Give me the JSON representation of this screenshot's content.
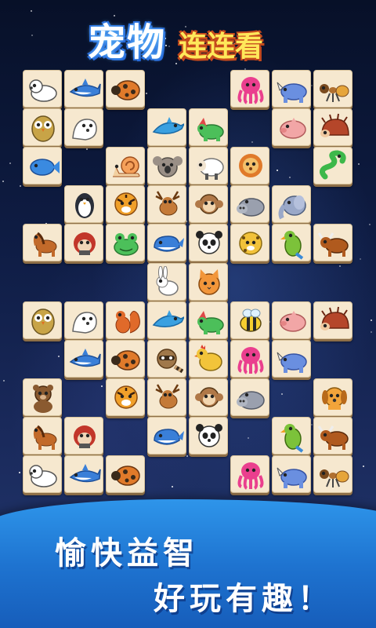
{
  "title": {
    "part1": "宠物",
    "part2": "连连看"
  },
  "slogans": [
    "愉快益智",
    "好玩有趣！"
  ],
  "colors": {
    "title_blue": "#1f5fd6",
    "title_yellow": "#ffe85a",
    "banner_blue": "#1e73d0",
    "tile_face": "#f6e8cf"
  },
  "board": {
    "columns": 9,
    "rows": 11,
    "tiles": [
      {
        "row": 0,
        "col": 0,
        "animal": "polar-bear"
      },
      {
        "row": 0,
        "col": 1,
        "animal": "shark"
      },
      {
        "row": 0,
        "col": 2,
        "animal": "ladybug"
      },
      {
        "row": 0,
        "col": 5,
        "animal": "octopus"
      },
      {
        "row": 0,
        "col": 6,
        "animal": "rhino"
      },
      {
        "row": 0,
        "col": 7,
        "animal": "ant"
      },
      {
        "row": 1,
        "col": 0,
        "animal": "owl"
      },
      {
        "row": 1,
        "col": 1,
        "animal": "seal"
      },
      {
        "row": 1,
        "col": 3,
        "animal": "dolphin"
      },
      {
        "row": 1,
        "col": 4,
        "animal": "triceratops"
      },
      {
        "row": 1,
        "col": 6,
        "animal": "pig"
      },
      {
        "row": 1,
        "col": 7,
        "animal": "hedgehog"
      },
      {
        "row": 2,
        "col": 0,
        "animal": "fish"
      },
      {
        "row": 2,
        "col": 2,
        "animal": "snail"
      },
      {
        "row": 2,
        "col": 3,
        "animal": "koala"
      },
      {
        "row": 2,
        "col": 4,
        "animal": "sheep"
      },
      {
        "row": 2,
        "col": 5,
        "animal": "lion"
      },
      {
        "row": 2,
        "col": 7,
        "animal": "snake"
      },
      {
        "row": 3,
        "col": 1,
        "animal": "penguin"
      },
      {
        "row": 3,
        "col": 2,
        "animal": "tiger"
      },
      {
        "row": 3,
        "col": 3,
        "animal": "deer"
      },
      {
        "row": 3,
        "col": 4,
        "animal": "monkey"
      },
      {
        "row": 3,
        "col": 5,
        "animal": "hippo"
      },
      {
        "row": 3,
        "col": 6,
        "animal": "elephant"
      },
      {
        "row": 4,
        "col": 0,
        "animal": "horse"
      },
      {
        "row": 4,
        "col": 1,
        "animal": "gorilla"
      },
      {
        "row": 4,
        "col": 2,
        "animal": "frog"
      },
      {
        "row": 4,
        "col": 3,
        "animal": "whale"
      },
      {
        "row": 4,
        "col": 4,
        "animal": "panda"
      },
      {
        "row": 4,
        "col": 5,
        "animal": "leopard"
      },
      {
        "row": 4,
        "col": 6,
        "animal": "parrot"
      },
      {
        "row": 4,
        "col": 7,
        "animal": "bull"
      },
      {
        "row": 5,
        "col": 3,
        "animal": "rabbit"
      },
      {
        "row": 5,
        "col": 4,
        "animal": "cat"
      },
      {
        "row": 6,
        "col": 0,
        "animal": "owl"
      },
      {
        "row": 6,
        "col": 1,
        "animal": "seal"
      },
      {
        "row": 6,
        "col": 2,
        "animal": "squirrel"
      },
      {
        "row": 6,
        "col": 3,
        "animal": "dolphin"
      },
      {
        "row": 6,
        "col": 4,
        "animal": "triceratops"
      },
      {
        "row": 6,
        "col": 5,
        "animal": "bee"
      },
      {
        "row": 6,
        "col": 6,
        "animal": "pig"
      },
      {
        "row": 6,
        "col": 7,
        "animal": "hedgehog"
      },
      {
        "row": 7,
        "col": 1,
        "animal": "shark"
      },
      {
        "row": 7,
        "col": 2,
        "animal": "ladybug"
      },
      {
        "row": 7,
        "col": 3,
        "animal": "raccoon"
      },
      {
        "row": 7,
        "col": 4,
        "animal": "chicken"
      },
      {
        "row": 7,
        "col": 5,
        "animal": "octopus"
      },
      {
        "row": 7,
        "col": 6,
        "animal": "rhino"
      },
      {
        "row": 8,
        "col": 0,
        "animal": "bear"
      },
      {
        "row": 8,
        "col": 2,
        "animal": "tiger"
      },
      {
        "row": 8,
        "col": 3,
        "animal": "deer"
      },
      {
        "row": 8,
        "col": 4,
        "animal": "monkey"
      },
      {
        "row": 8,
        "col": 5,
        "animal": "hippo"
      },
      {
        "row": 8,
        "col": 7,
        "animal": "dog"
      },
      {
        "row": 9,
        "col": 0,
        "animal": "horse"
      },
      {
        "row": 9,
        "col": 1,
        "animal": "gorilla"
      },
      {
        "row": 9,
        "col": 3,
        "animal": "whale"
      },
      {
        "row": 9,
        "col": 4,
        "animal": "panda"
      },
      {
        "row": 9,
        "col": 6,
        "animal": "parrot"
      },
      {
        "row": 9,
        "col": 7,
        "animal": "bull"
      },
      {
        "row": 10,
        "col": 0,
        "animal": "polar-bear"
      },
      {
        "row": 10,
        "col": 1,
        "animal": "shark"
      },
      {
        "row": 10,
        "col": 2,
        "animal": "ladybug"
      },
      {
        "row": 10,
        "col": 5,
        "animal": "octopus"
      },
      {
        "row": 10,
        "col": 6,
        "animal": "rhino"
      },
      {
        "row": 10,
        "col": 7,
        "animal": "ant"
      }
    ]
  }
}
